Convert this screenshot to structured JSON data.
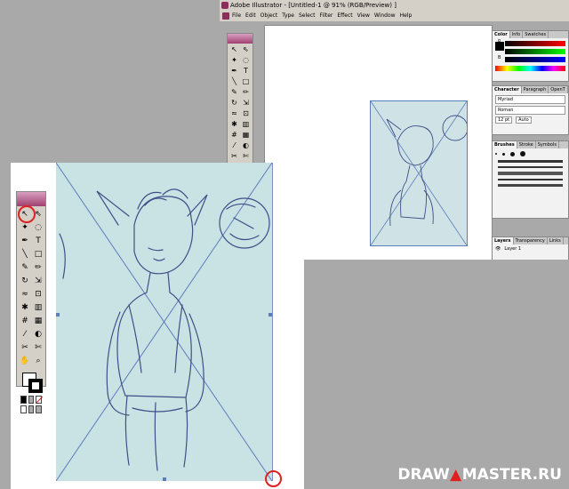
{
  "back_window": {
    "title": "Adobe Illustrator - [Untitled-1 @ 91% (RGB/Preview) ]",
    "menu": [
      "File",
      "Edit",
      "Object",
      "Type",
      "Select",
      "Filter",
      "Effect",
      "View",
      "Window",
      "Help"
    ]
  },
  "panels": {
    "color": {
      "tabs": [
        "Color",
        "Info",
        "Swatches"
      ],
      "channels": [
        "R",
        "G",
        "B"
      ]
    },
    "character": {
      "tabs": [
        "Character",
        "Paragraph",
        "OpenT"
      ],
      "font": "Myriad",
      "style": "Roman",
      "size": "12 pt",
      "leading": "Auto"
    },
    "brushes": {
      "tabs": [
        "Brushes",
        "Stroke",
        "Symbols"
      ]
    },
    "layers": {
      "tabs": [
        "Layers",
        "Transparency",
        "Links"
      ],
      "layer_name": "Layer 1"
    }
  },
  "watermark": {
    "part1": "DRAW",
    "part2": "MASTER.RU"
  },
  "colors": {
    "accent_circle": "#e02020",
    "artboard_line": "#5d7dbd",
    "sketch_paper": "#c9e2e3"
  }
}
